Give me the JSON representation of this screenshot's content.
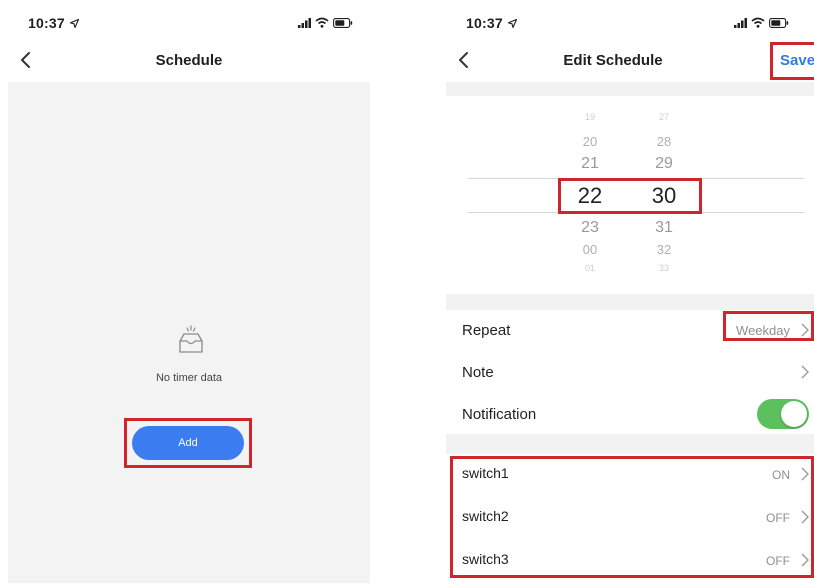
{
  "screens": {
    "schedule": {
      "status_time": "10:37",
      "title": "Schedule",
      "empty_text": "No timer data",
      "add_label": "Add"
    },
    "edit": {
      "status_time": "10:37",
      "title": "Edit Schedule",
      "save_label": "Save",
      "picker": {
        "hours": [
          "19",
          "20",
          "21",
          "22",
          "23",
          "00",
          "01"
        ],
        "minutes": [
          "27",
          "28",
          "29",
          "30",
          "31",
          "32",
          "33"
        ],
        "selected_hour": "22",
        "selected_minute": "30"
      },
      "repeat": {
        "label": "Repeat",
        "value": "Weekday"
      },
      "note": {
        "label": "Note"
      },
      "notification": {
        "label": "Notification",
        "enabled": true
      },
      "switches": [
        {
          "label": "switch1",
          "value": "ON"
        },
        {
          "label": "switch2",
          "value": "OFF"
        },
        {
          "label": "switch3",
          "value": "OFF"
        }
      ]
    }
  },
  "colors": {
    "accent_blue": "#3b7cf0",
    "save_blue": "#2f7de0",
    "highlight_red": "#d0262b",
    "toggle_green": "#5cc05f",
    "background_gray": "#f2f2f2"
  }
}
